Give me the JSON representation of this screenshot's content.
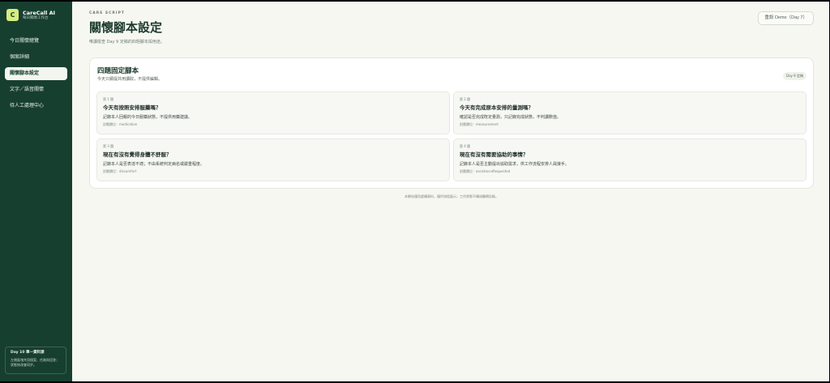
{
  "brand": {
    "logo_letter": "C",
    "name": "CareCall AI",
    "subtitle": "每日關懷工作台"
  },
  "sidebar": {
    "items": [
      {
        "label": "今日關懷總覽"
      },
      {
        "label": "個案詳細"
      },
      {
        "label": "關懷腳本設定",
        "active": true
      },
      {
        "label": "文字／語音關懷"
      },
      {
        "label": "待人工處理中心"
      }
    ],
    "card": {
      "title": "Day 10 單一資料源",
      "text": "左側區塊共用個案、任務與回答；狀態修改會同步。"
    }
  },
  "header": {
    "eyebrow": "CARE SCRIPT",
    "title": "關懷腳本設定",
    "description": "唯讀檢查 Day 9 定稿的四題腳本與用途。",
    "reset_button": "重設 Demo（Day 7）"
  },
  "script_card": {
    "title": "四題固定腳本",
    "subtitle": "今天只顯提共用讀取，不提供編輯。",
    "badge": "Day 9 定稿",
    "questions": [
      {
        "num": "第 1 題",
        "title": "今天有按照安排服藥嗎？",
        "desc": "記錄本人回報的今日服藥狀態，不提供用藥建議。",
        "field": "對應欄位：medication"
      },
      {
        "num": "第 2 題",
        "title": "今天有完成原本安排的量測嗎？",
        "desc": "確認是否完成既定量測，只記錄完成狀態，不判讀數值。",
        "field": "對應欄位：measurement"
      },
      {
        "num": "第 3 題",
        "title": "現在有沒有覺得身體不舒服？",
        "desc": "記錄本人是否表達不適；不由系統判定病名或嚴重程度。",
        "field": "對應欄位：discomfort"
      },
      {
        "num": "第 4 題",
        "title": "現在有沒有需要協助的事情？",
        "desc": "記錄本人是否主動提出協助需求，供工作流程安排人員接手。",
        "field": "對應欄位：assistanceRequested"
      }
    ]
  },
  "footer": {
    "note": "本網站僅用虛構資料，僅供流程展示；工作狀態不構成醫療診斷。"
  },
  "colors": {
    "sidebar": "#173f2f",
    "accent": "#d9ec7f",
    "background": "#f7f7f2"
  }
}
